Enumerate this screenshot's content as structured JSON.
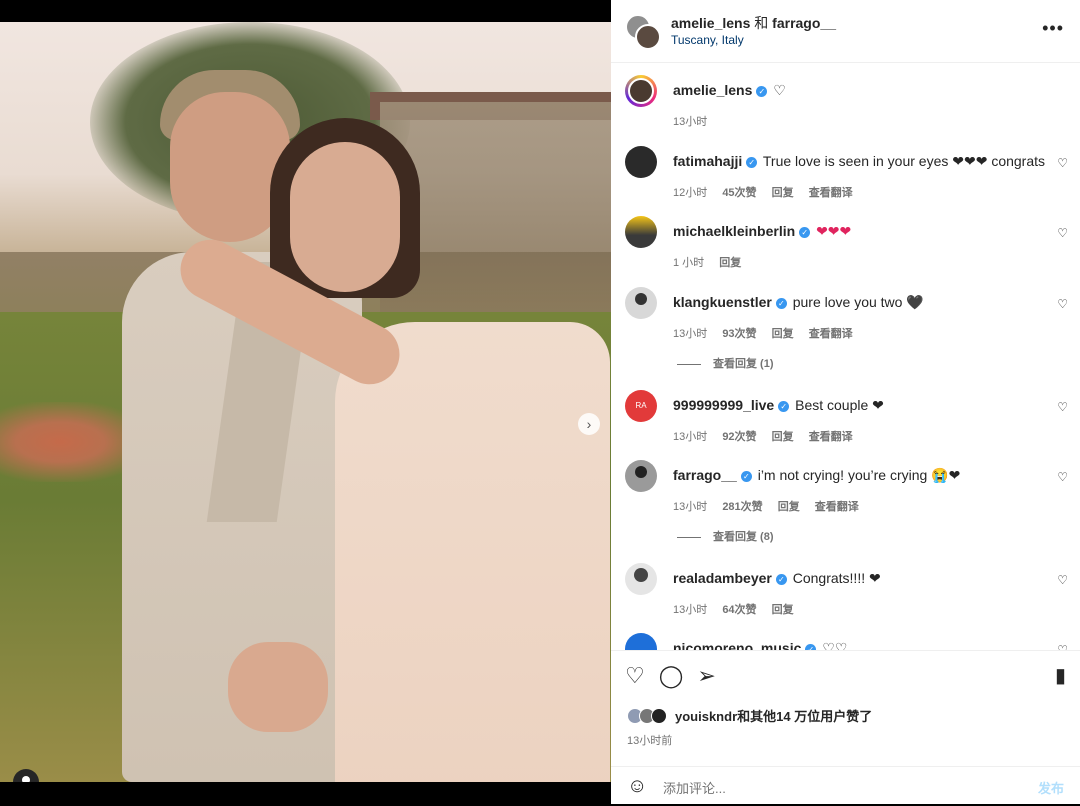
{
  "post": {
    "author_a": "amelie_lens",
    "connector": "和",
    "author_b": "farrago__",
    "location": "Tuscany, Italy",
    "more_icon": "more-icon",
    "carousel_pages": 4,
    "carousel_current": 1
  },
  "caption": {
    "username": "amelie_lens",
    "emoji": "♡",
    "time": "13小时"
  },
  "comments": [
    {
      "username": "fatimahajji",
      "text": "True love is seen in your eyes ❤❤❤ congrats",
      "time": "12小时",
      "likes": "45次赞",
      "reply": "回复",
      "translate": "查看翻译"
    },
    {
      "username": "michaelkleinberlin",
      "text": "❤❤❤",
      "time": "1 小时",
      "likes": "",
      "reply": "回复",
      "translate": ""
    },
    {
      "username": "klangkuenstler",
      "text": "pure love you two 🖤",
      "time": "13小时",
      "likes": "93次赞",
      "reply": "回复",
      "translate": "查看翻译"
    },
    {
      "username": "999999999_live",
      "text": "Best couple ❤",
      "time": "13小时",
      "likes": "92次赞",
      "reply": "回复",
      "translate": "查看翻译"
    },
    {
      "username": "farrago__",
      "text": "i’m not crying! you’re crying 😭❤",
      "time": "13小时",
      "likes": "281次赞",
      "reply": "回复",
      "translate": "查看翻译"
    },
    {
      "username": "realadambeyer",
      "text": "Congrats!!!! ❤",
      "time": "13小时",
      "likes": "64次赞",
      "reply": "回复",
      "translate": ""
    },
    {
      "username": "nicomoreno_music",
      "text": "♡♡",
      "time": "",
      "likes": "",
      "reply": "",
      "translate": ""
    }
  ],
  "reply_threads": [
    {
      "label": "查看回复 (1)"
    },
    {
      "label": "查看回复 (8)"
    }
  ],
  "footer": {
    "likes_text": "youiskndr和其他14 万位用户赞了",
    "time": "13小时前",
    "comment_placeholder": "添加评论...",
    "post_label": "发布"
  },
  "colors": {
    "verified": "#3897f0",
    "link": "#00376b",
    "muted": "#737373",
    "post_disabled": "#b2dffc"
  }
}
